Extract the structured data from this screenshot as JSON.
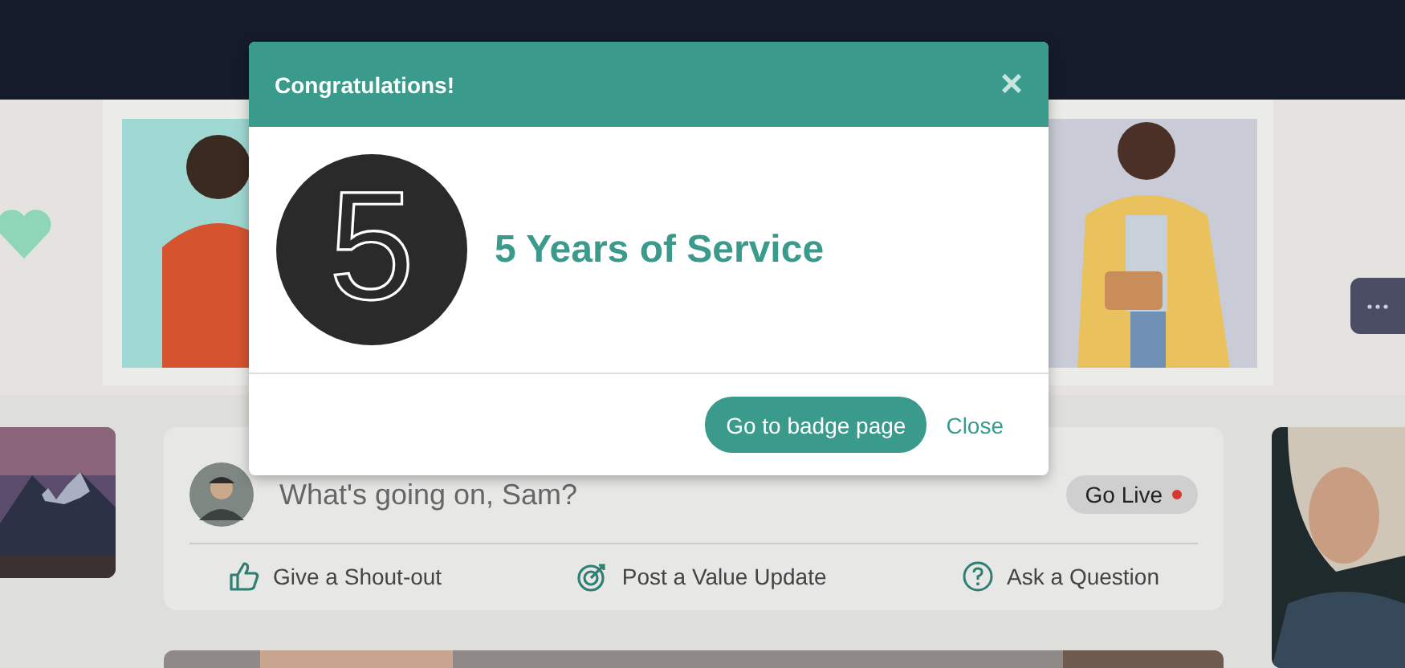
{
  "modal": {
    "title": "Congratulations!",
    "close": "×",
    "badge_number": "5",
    "badge_title": "5 Years of Service",
    "primary_button": "Go to badge page",
    "secondary_button": "Close"
  },
  "composer": {
    "placeholder": "What's going on, Sam?",
    "go_live": "Go Live",
    "actions": [
      {
        "kind": "shoutout",
        "label": "Give a Shout-out"
      },
      {
        "kind": "value",
        "label": "Post a Value Update"
      },
      {
        "kind": "question",
        "label": "Ask a Question"
      }
    ]
  }
}
